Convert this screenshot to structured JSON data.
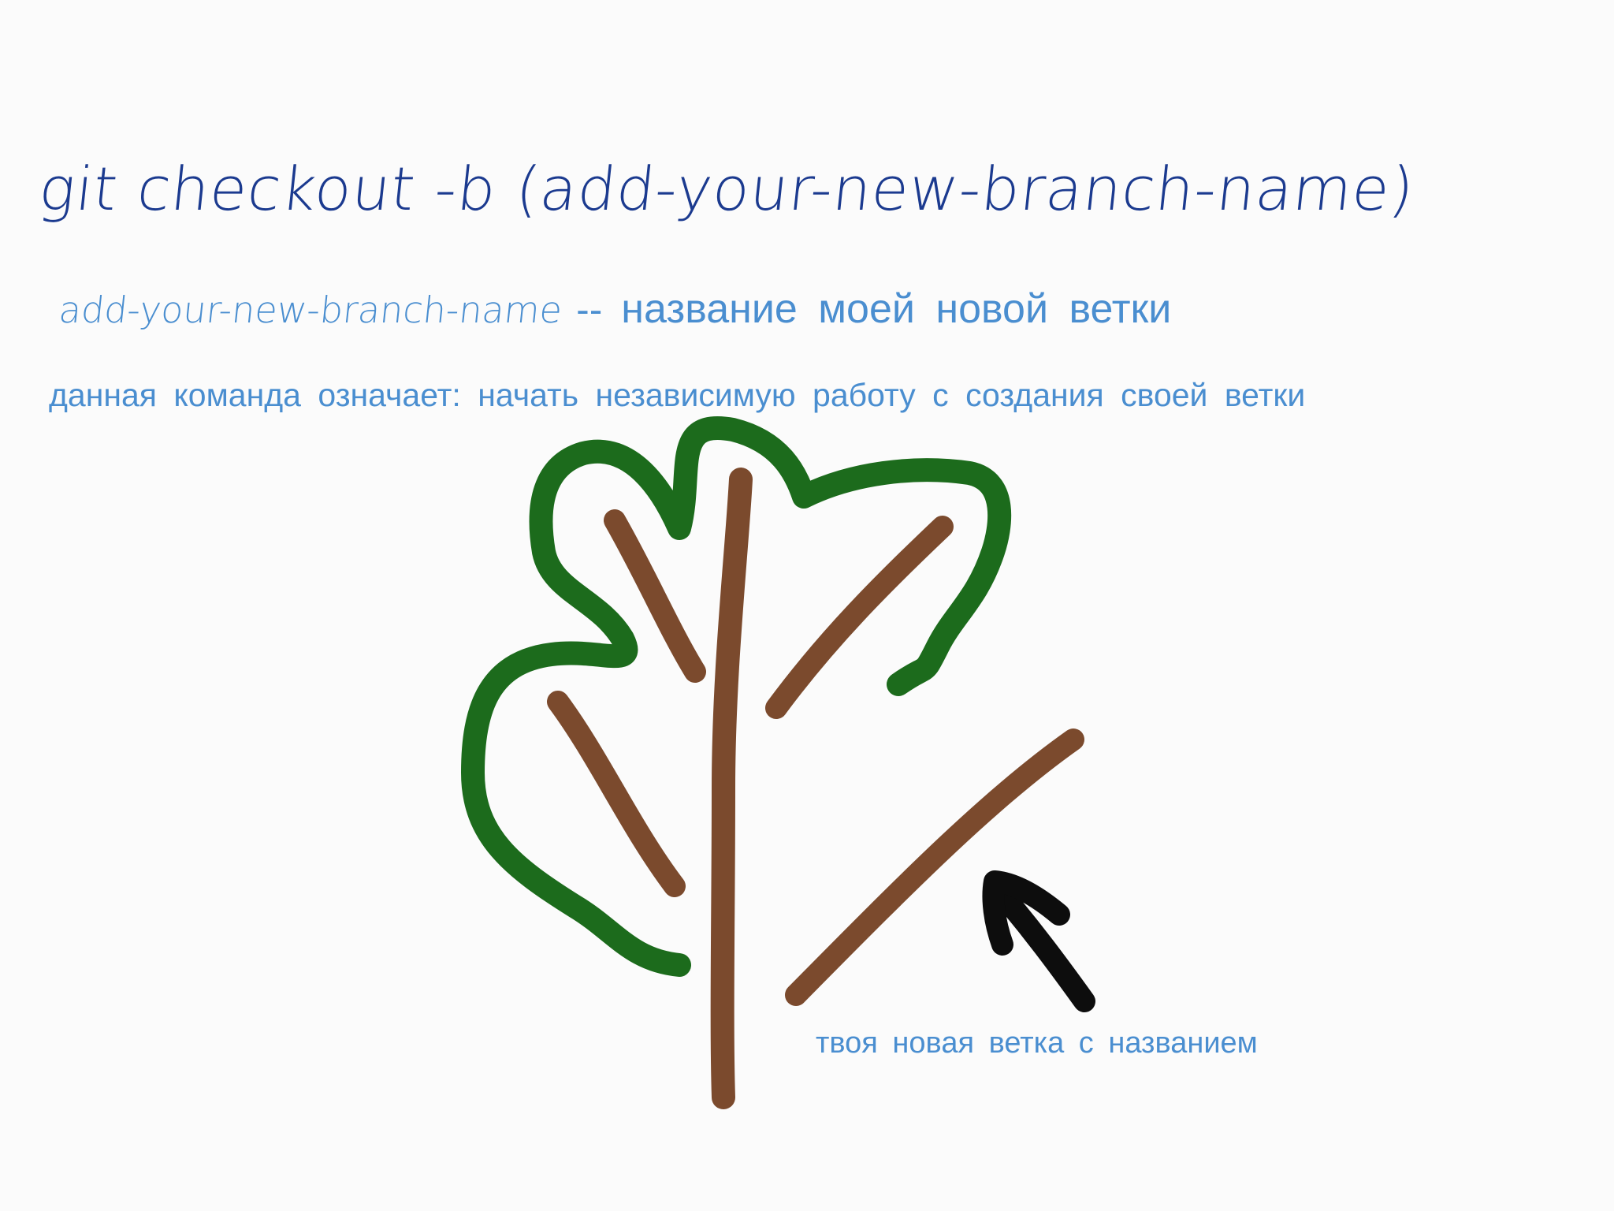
{
  "heading": {
    "command": "git checkout -b (add-your-new-branch-name)"
  },
  "explanation": {
    "placeholder_name": "add-your-new-branch-name",
    "separator": "--",
    "meaning": "название моей новой ветки"
  },
  "description": "данная команда означает: начать независимую работу с создания своей ветки",
  "annotation": {
    "caption": "твоя новая ветка с названием"
  },
  "colors": {
    "title": "#1b3a8f",
    "text": "#4a8ed0",
    "foliage": "#1c6b1c",
    "branch": "#7b4a2d",
    "arrow": "#0d0d0d"
  },
  "icons": [
    "tree-drawing",
    "arrow-icon"
  ]
}
